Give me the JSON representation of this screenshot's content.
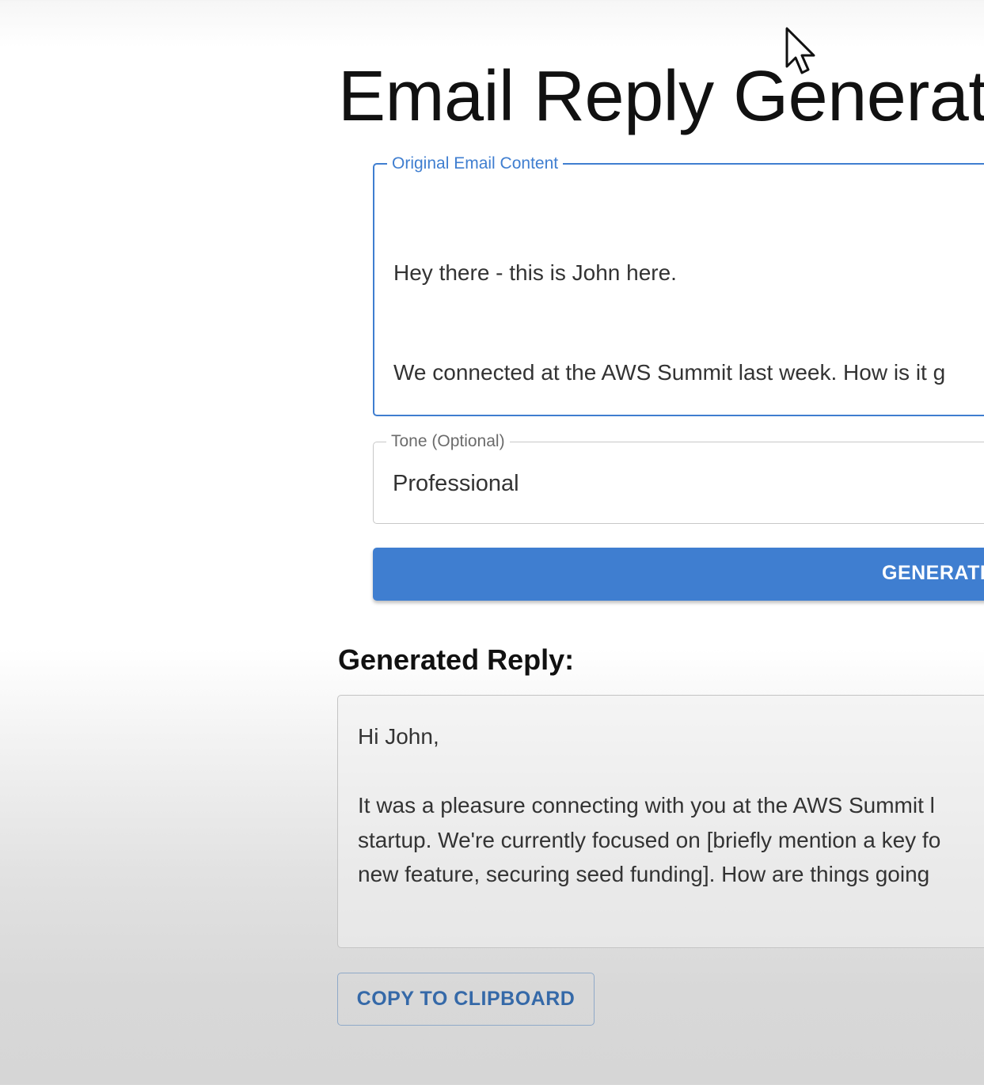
{
  "page": {
    "title": "Email Reply Generato"
  },
  "email_field": {
    "label": "Original Email Content",
    "lines": [
      "Hey there - this is John here.",
      "We connected at the AWS Summit last week. How is it g"
    ]
  },
  "tone_field": {
    "label": "Tone (Optional)",
    "value": "Professional"
  },
  "generate_button": {
    "label": "GENERATE"
  },
  "reply": {
    "heading": "Generated Reply:",
    "lines": [
      "Hi John,",
      "",
      "It was a pleasure connecting with you at the AWS Summit l",
      "startup. We're currently focused on [briefly mention a key fo",
      "new feature, securing seed funding].  How are things going"
    ]
  },
  "copy_button": {
    "label": "COPY TO CLIPBOARD"
  },
  "colors": {
    "accent": "#3f7ed0",
    "button_text": "#ffffff",
    "outline_button_text": "#3569a8"
  },
  "icons": {
    "cursor": "mouse-pointer-icon"
  }
}
